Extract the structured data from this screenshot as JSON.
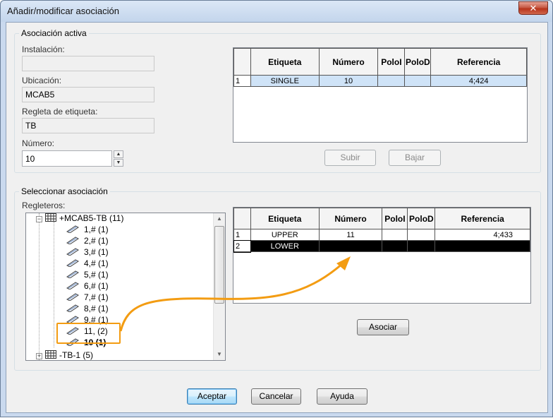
{
  "window": {
    "title": "Añadir/modificar asociación",
    "close_glyph": "✕"
  },
  "active_group": {
    "label": "Asociación activa",
    "installation_label": "Instalación:",
    "installation_value": "",
    "location_label": "Ubicación:",
    "location_value": "MCAB5",
    "strip_label": "Regleta de etiqueta:",
    "strip_value": "TB",
    "number_label": "Número:",
    "number_value": "10",
    "grid": {
      "headers": [
        "Etiqueta",
        "Número",
        "PoloI",
        "PoloD",
        "Referencia"
      ],
      "rows": [
        {
          "index": "1",
          "cells": [
            "SINGLE",
            "10",
            "",
            "",
            "4;424"
          ]
        }
      ]
    },
    "up_button": "Subir",
    "down_button": "Bajar"
  },
  "select_group": {
    "label": "Seleccionar asociación",
    "strips_label": "Regleteros:",
    "tree": {
      "root": "+MCAB5-TB (11)",
      "children": [
        "1,# (1)",
        "2,# (1)",
        "3,# (1)",
        "4,# (1)",
        "5,# (1)",
        "6,# (1)",
        "7,# (1)",
        "8,# (1)",
        "9,# (1)",
        "11,  (2)",
        "10 (1)"
      ],
      "second_root": "-TB-1 (5)"
    },
    "grid": {
      "headers": [
        "Etiqueta",
        "Número",
        "PoloI",
        "PoloD",
        "Referencia"
      ],
      "rows": [
        {
          "index": "1",
          "cells": [
            "UPPER",
            "11",
            "",
            "",
            "4;433"
          ]
        },
        {
          "index": "2",
          "cells": [
            "LOWER",
            "",
            "",
            "",
            ""
          ]
        }
      ]
    },
    "associate_button": "Asociar"
  },
  "footer": {
    "ok": "Aceptar",
    "cancel": "Cancelar",
    "help": "Ayuda"
  },
  "icons": {
    "terminal_strip_icon": "grid-icon",
    "terminal_icon": "wire-icon",
    "annotation_color": "#f39c12"
  }
}
